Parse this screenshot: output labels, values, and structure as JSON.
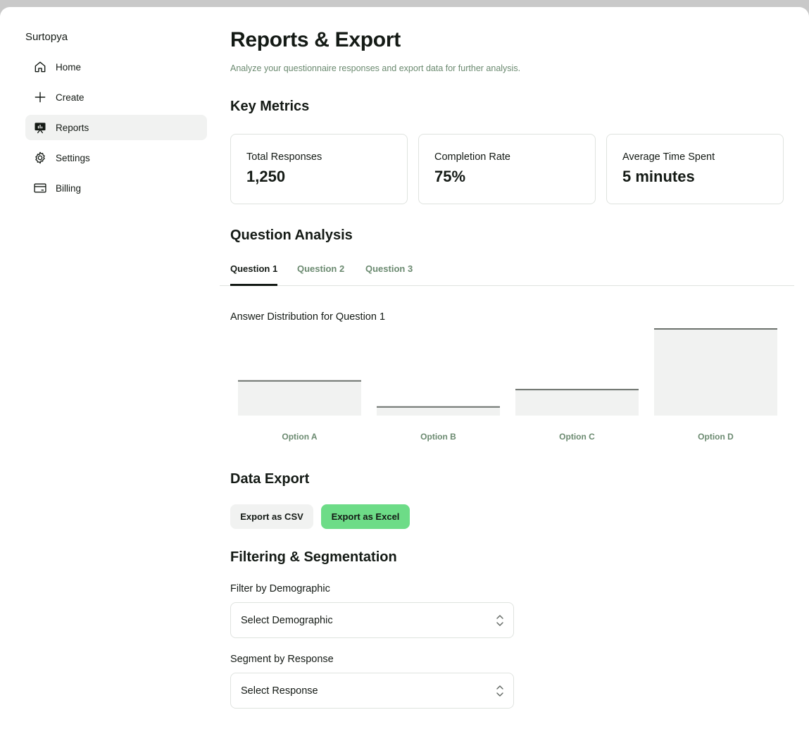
{
  "brand": "Surtopya",
  "nav": {
    "items": [
      {
        "label": "Home",
        "icon": "home-icon"
      },
      {
        "label": "Create",
        "icon": "plus-icon"
      },
      {
        "label": "Reports",
        "icon": "presentation-chart-icon"
      },
      {
        "label": "Settings",
        "icon": "gear-icon"
      },
      {
        "label": "Billing",
        "icon": "credit-card-icon"
      }
    ],
    "active": "Reports"
  },
  "header": {
    "title": "Reports & Export",
    "subtitle": "Analyze your questionnaire responses and export data for further analysis."
  },
  "key_metrics": {
    "title": "Key Metrics",
    "cards": [
      {
        "label": "Total Responses",
        "value": "1,250"
      },
      {
        "label": "Completion Rate",
        "value": "75%"
      },
      {
        "label": "Average Time Spent",
        "value": "5 minutes"
      }
    ]
  },
  "question_analysis": {
    "title": "Question Analysis",
    "tabs": [
      "Question 1",
      "Question 2",
      "Question 3"
    ],
    "active_tab": "Question 1",
    "chart_title": "Answer Distribution for Question 1"
  },
  "chart_data": {
    "type": "bar",
    "title": "Answer Distribution for Question 1",
    "categories": [
      "Option A",
      "Option B",
      "Option C",
      "Option D"
    ],
    "values": [
      40,
      10,
      30,
      100
    ],
    "ylim": [
      0,
      100
    ],
    "grid": false
  },
  "data_export": {
    "title": "Data Export",
    "csv_label": "Export as CSV",
    "excel_label": "Export as Excel"
  },
  "filtering": {
    "title": "Filtering & Segmentation",
    "demographic_label": "Filter by Demographic",
    "demographic_value": "Select Demographic",
    "response_label": "Segment by Response",
    "response_value": "Select Response"
  },
  "colors": {
    "accent": "#6ddc87",
    "muted_text": "#6b8a70",
    "bar_fill": "#f1f2f1",
    "bar_top": "#6b716c"
  }
}
